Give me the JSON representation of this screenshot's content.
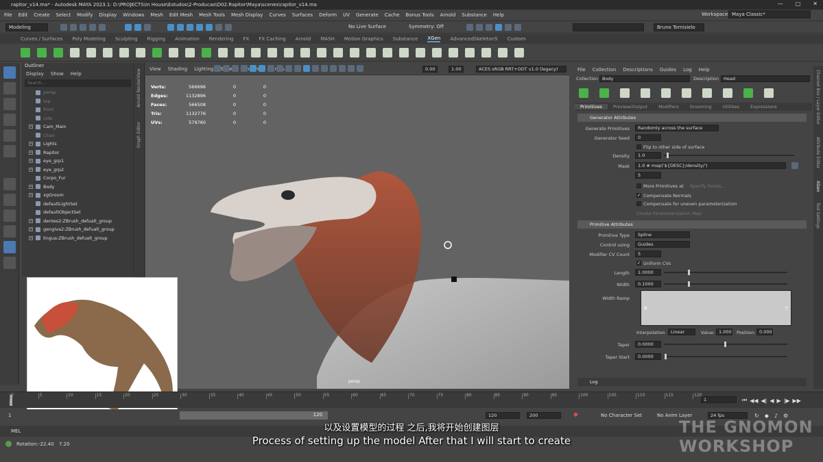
{
  "window": {
    "title": "rapitor_v14.ma* - Autodesk MAYA 2023.1: D:\\PROJECTS\\In House\\Estudos\\2-Producao\\D02.Rapitor\\Maya\\scenes\\rapitor_v14.ma"
  },
  "menubar": [
    "File",
    "Edit",
    "Create",
    "Select",
    "Modify",
    "Display",
    "Windows",
    "Mesh",
    "Edit Mesh",
    "Mesh Tools",
    "Mesh Display",
    "Curves",
    "Surfaces",
    "Deform",
    "UV",
    "Generate",
    "Cache",
    "Bonus Tools",
    "Arnold",
    "Substance",
    "Help"
  ],
  "workspace": {
    "label": "Workspace:",
    "value": "Maya Classic*"
  },
  "status": {
    "mode": "Modeling",
    "live_surface": "No Live Surface",
    "symmetry": "Symmetry: Off",
    "user": "Bruno Tornisielo"
  },
  "shelf_tabs": [
    "Curves / Surfaces",
    "Poly Modeling",
    "Sculpting",
    "Rigging",
    "Animation",
    "Rendering",
    "FX",
    "FX Caching",
    "Arnold",
    "MASH",
    "Motion Graphics",
    "Substance",
    "XGen",
    "AdvancedSkeleton5",
    "Custom"
  ],
  "shelf_active": "XGen",
  "outliner": {
    "title": "Outliner",
    "menu": [
      "Display",
      "Show",
      "Help"
    ],
    "search_placeholder": "Search...",
    "items": [
      {
        "label": "persp",
        "dim": true,
        "expand": false
      },
      {
        "label": "top",
        "dim": true,
        "expand": false
      },
      {
        "label": "front",
        "dim": true,
        "expand": false
      },
      {
        "label": "side",
        "dim": true,
        "expand": false
      },
      {
        "label": "Cam_Main",
        "dim": false,
        "expand": true
      },
      {
        "label": "Chao",
        "dim": true,
        "expand": false
      },
      {
        "label": "Lights",
        "dim": false,
        "expand": true
      },
      {
        "label": "Rapitor",
        "dim": false,
        "expand": true
      },
      {
        "label": "eye_grp1",
        "dim": false,
        "expand": true
      },
      {
        "label": "eye_grp2",
        "dim": false,
        "expand": true
      },
      {
        "label": "Corpo_Fur",
        "dim": false,
        "expand": false
      },
      {
        "label": "Body",
        "dim": false,
        "expand": true
      },
      {
        "label": "xgGroom",
        "dim": false,
        "expand": true
      },
      {
        "label": "defaultLightSet",
        "dim": false,
        "expand": false
      },
      {
        "label": "defaultObjectSet",
        "dim": false,
        "expand": false
      },
      {
        "label": "dentes2:ZBrush_defualt_group",
        "dim": false,
        "expand": true
      },
      {
        "label": "gengiva2:ZBrush_defualt_group",
        "dim": false,
        "expand": true
      },
      {
        "label": "lingua:ZBrush_defualt_group",
        "dim": false,
        "expand": true
      }
    ]
  },
  "side_strip": [
    "Arnold RenderView",
    "Graph Editor"
  ],
  "viewport": {
    "menu": [
      "View",
      "Shading",
      "Lighting",
      "Show",
      "Renderer",
      "Panels"
    ],
    "exposure": "0.00",
    "gamma": "1.00",
    "color_space": "ACES sRGB RRT+ODT v1.0 (legacy)",
    "camera": "persp",
    "hud": [
      {
        "label": "Verts:",
        "v1": "566696",
        "v2": "0",
        "v3": "0"
      },
      {
        "label": "Edges:",
        "v1": "1132896",
        "v2": "0",
        "v3": "0"
      },
      {
        "label": "Faces:",
        "v1": "566508",
        "v2": "0",
        "v3": "0"
      },
      {
        "label": "Tris:",
        "v1": "1132776",
        "v2": "0",
        "v3": "0"
      },
      {
        "label": "UVs:",
        "v1": "579760",
        "v2": "0",
        "v3": "0"
      }
    ]
  },
  "xgen": {
    "menu": [
      "File",
      "Collection",
      "Descriptions",
      "Guides",
      "Log",
      "Help"
    ],
    "collection_label": "Collection",
    "collection_value": "Body",
    "description_label": "Description",
    "description_value": "Head",
    "tabs": [
      "Primitives",
      "Preview/Output",
      "Modifiers",
      "Grooming",
      "Utilities",
      "Expressions"
    ],
    "active_tab": "Primitives",
    "generator_section": "Generator Attributes",
    "generate_primitives_label": "Generate Primitives",
    "generate_primitives_value": "Randomly across the surface",
    "generator_seed_label": "Generator Seed",
    "generator_seed_value": "0",
    "flip_label": "Flip to other side of surface",
    "density_label": "Density",
    "density_value": "1.0",
    "mask_label": "Mask",
    "mask_value": "1.0 # map('${DESC}/density/')",
    "mask_extra": "5",
    "more_primitives_label": "More Primitives at",
    "specify_points": "Specify Points...",
    "compensate_normals": "Compensate Normals",
    "compensate_uneven": "Compensate for uneven parameterization",
    "create_param_map": "Create Parameterization Map",
    "primitive_section": "Primitive Attributes",
    "primitive_type_label": "Primitive Type",
    "primitive_type_value": "Spline",
    "control_using_label": "Control using",
    "control_using_value": "Guides",
    "modifier_cv_label": "Modifier CV Count",
    "modifier_cv_value": "5",
    "uniform_cvs": "Uniform CVs",
    "length_label": "Length",
    "length_value": "1.0000",
    "width_label": "Width",
    "width_value": "0.1000",
    "width_ramp_label": "Width Ramp",
    "ramp_left": "R",
    "ramp_right": "T",
    "interpolation_label": "Interpolation",
    "interpolation_value": "Linear",
    "value_label": "Value:",
    "value_value": "1.000",
    "position_label": "Position:",
    "position_value": "0.000",
    "taper_label": "Taper",
    "taper_value": "0.0000",
    "taper_start_label": "Taper Start",
    "taper_start_value": "0.0000",
    "log_label": "Log"
  },
  "right_strip": [
    "Channel Box / Layer Editor",
    "Attribute Editor",
    "XGen",
    "Tool Settings"
  ],
  "timeline": {
    "ticks": [
      "0",
      "5",
      "10",
      "15",
      "20",
      "25",
      "30",
      "35",
      "40",
      "45",
      "50",
      "55",
      "60",
      "65",
      "70",
      "75",
      "80",
      "85",
      "90",
      "95",
      "100",
      "105",
      "110",
      "115",
      "120"
    ],
    "current_frame": "1"
  },
  "range": {
    "start": "1",
    "start2": "1",
    "range_end": "120",
    "end": "120",
    "anim_end": "200",
    "character_set": "No Character Set",
    "anim_layer": "No Anim Layer",
    "fps": "24 fps"
  },
  "cmdline": {
    "label": "MEL"
  },
  "helpline": {
    "label": "Rotation:",
    "v1": "-22.40",
    "v2": "7.20"
  },
  "subtitle": {
    "cn": "以及设置模型的过程 之后,我将开始创建图层",
    "en": "Process of setting up the model  After that I will start to create"
  },
  "watermark": {
    "line1": "THE GNOMON",
    "line2": "WORKSHOP"
  },
  "colors": {
    "accent": "#4a90c8",
    "shelf_green": "#4bb24b",
    "fur": "#a0522d"
  }
}
